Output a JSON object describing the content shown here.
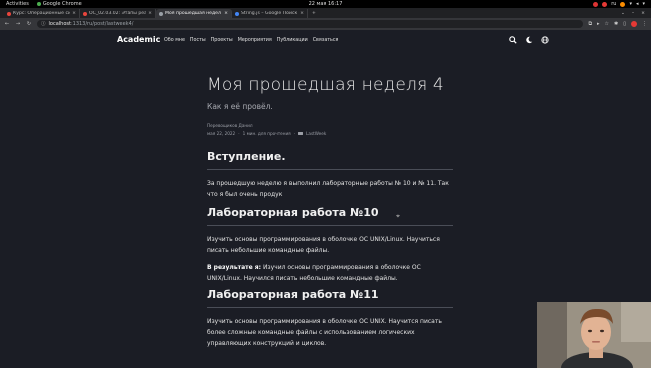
{
  "gnome": {
    "activities": "Activities",
    "app": "Google Chrome",
    "clock": "22 мая 16:17"
  },
  "browser": {
    "tabs": [
      {
        "title": "Курс: Операционные си",
        "favicon_color": "#e8453c",
        "active": false
      },
      {
        "title": "ОС_02.03.02: Этапы реал",
        "favicon_color": "#e8453c",
        "active": false
      },
      {
        "title": "Моя прошедшая недел",
        "favicon_color": "#9aa0a6",
        "active": true
      },
      {
        "title": "String.js – Google Поиск",
        "favicon_color": "#4285f4",
        "active": false
      }
    ],
    "new_tab": "+",
    "address": {
      "host": "localhost",
      "path": ":1313/ru/post/lastweek4/"
    }
  },
  "site": {
    "brand": "Academic",
    "menu": [
      "Обо мне",
      "Посты",
      "Проекты",
      "Мероприятия",
      "Публикации",
      "Связаться"
    ],
    "icons": [
      "search-icon",
      "moon-icon",
      "globe-icon"
    ]
  },
  "article": {
    "title": "Моя прошедшая неделя 4",
    "subtitle": "Как я её провёл.",
    "author": "Перевощиков Данил",
    "date": "мая 22, 2022",
    "read_time": "1 мин. для прочтения",
    "category": "LastWeek",
    "sections": [
      {
        "heading": "Вступление.",
        "paragraphs": [
          {
            "bold": "",
            "text": "За прошедшую неделю я выполнил лабораторные работы № 10 и № 11. Так что я был очень продук"
          }
        ]
      },
      {
        "heading": "Лабораторная работа №10",
        "paragraphs": [
          {
            "bold": "",
            "text": "Изучить основы программирования в оболочке ОС UNIX/Linux. Научиться писать небольшие командные файлы."
          },
          {
            "bold": "В результате я:",
            "text": " Изучил основы программирования в оболочке ОС UNIX/Linux. Научился писать небольшие командные файлы."
          }
        ]
      },
      {
        "heading": "Лабораторная работа №11",
        "paragraphs": [
          {
            "bold": "",
            "text": "Изучить основы программирования в оболочке ОС UNIX. Научится писать более сложные командные файлы с использованием логических управляющих конструкций и циклов."
          }
        ]
      }
    ]
  },
  "colors": {
    "page_bg": "#1b1d25",
    "text": "#e3e3e3",
    "muted": "#a7a9b0",
    "browser_chrome": "#35363a"
  }
}
